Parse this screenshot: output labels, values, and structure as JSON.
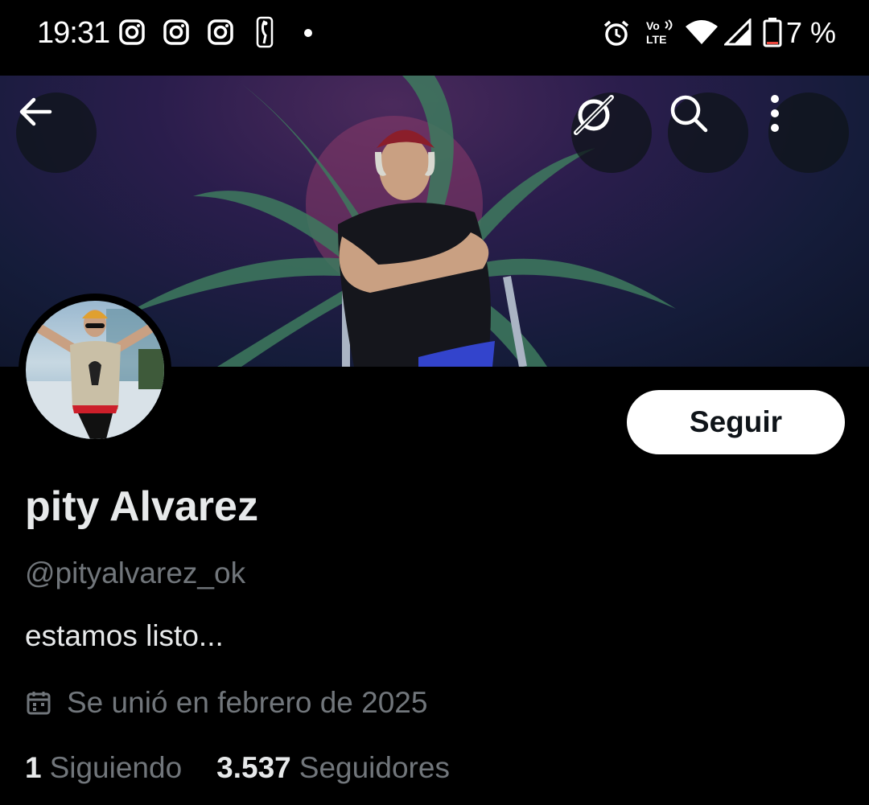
{
  "status_bar": {
    "time": "19:31",
    "battery": "7 %",
    "notification_icons": [
      "instagram-icon",
      "instagram-icon",
      "instagram-icon",
      "nba-icon"
    ],
    "system_icons": [
      "alarm-icon",
      "volte-icon",
      "wifi-icon",
      "signal-icon",
      "battery-icon"
    ]
  },
  "header": {
    "icons": [
      "back-arrow-icon",
      "grok-icon",
      "search-icon",
      "more-vertical-icon"
    ]
  },
  "profile": {
    "follow_label": "Seguir",
    "display_name": "pity Alvarez",
    "handle": "@pityalvarez_ok",
    "bio": "estamos listo...",
    "joined": "Se unió en febrero de 2025",
    "following_count": "1",
    "following_label": "Siguiendo",
    "followers_count": "3.537",
    "followers_label": "Seguidores"
  },
  "colors": {
    "background": "#000000",
    "primary_text": "#e7e9ea",
    "secondary_text": "#71767b",
    "follow_button_bg": "#ffffff"
  }
}
